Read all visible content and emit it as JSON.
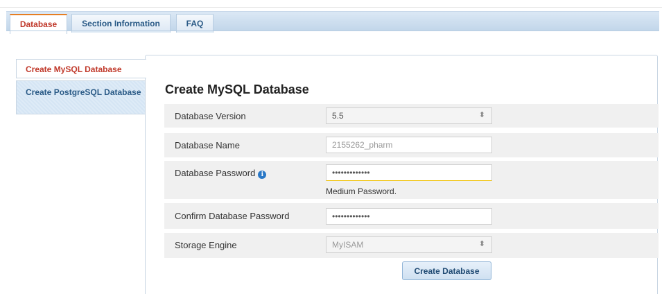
{
  "tabs": [
    {
      "label": "Database",
      "active": true
    },
    {
      "label": "Section Information",
      "active": false
    },
    {
      "label": "FAQ",
      "active": false
    }
  ],
  "sidebar": {
    "items": [
      {
        "label": "Create MySQL Database",
        "active": true
      },
      {
        "label": "Create PostgreSQL Database",
        "active": false
      }
    ]
  },
  "form": {
    "title": "Create MySQL Database",
    "version": {
      "label": "Database Version",
      "value": "5.5"
    },
    "name": {
      "label": "Database Name",
      "value": "2155262_pharm"
    },
    "password": {
      "label": "Database Password",
      "value": "•••••••••••••",
      "strength": "Medium Password."
    },
    "confirm": {
      "label": "Confirm Database Password",
      "value": "•••••••••••••"
    },
    "engine": {
      "label": "Storage Engine",
      "value": "MyISAM"
    },
    "submit_label": "Create Database"
  },
  "colors": {
    "active_tab_text": "#c0392b",
    "link_text": "#2a5a86",
    "tab_bar": "#c2d6ea",
    "info_icon": "#2a78c6"
  }
}
